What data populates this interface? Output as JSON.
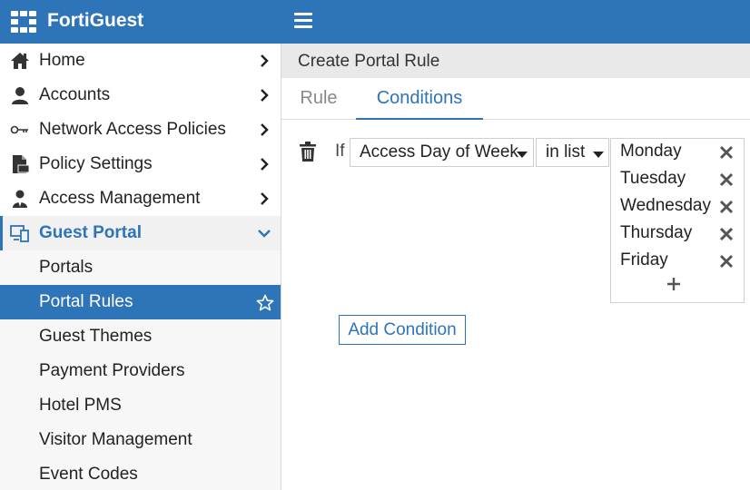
{
  "app": {
    "brand": "FortiGuest",
    "logo_icon": "fortinet-logo-icon",
    "menu_icon": "hamburger-icon",
    "accent_color": "#2d74b8"
  },
  "sidebar": {
    "items": [
      {
        "label": "Home",
        "icon": "home-icon"
      },
      {
        "label": "Accounts",
        "icon": "user-icon"
      },
      {
        "label": "Network Access Policies",
        "icon": "key-icon"
      },
      {
        "label": "Policy Settings",
        "icon": "document-icon"
      },
      {
        "label": "Access Management",
        "icon": "admin-user-icon"
      },
      {
        "label": "Guest Portal",
        "icon": "monitor-icon",
        "expanded": true
      }
    ],
    "sub_items": [
      {
        "label": "Portals"
      },
      {
        "label": "Portal Rules",
        "selected": true,
        "icon": "star-icon"
      },
      {
        "label": "Guest Themes"
      },
      {
        "label": "Payment Providers"
      },
      {
        "label": "Hotel PMS"
      },
      {
        "label": "Visitor Management"
      },
      {
        "label": "Event Codes"
      }
    ]
  },
  "main": {
    "title": "Create Portal Rule",
    "tabs": [
      {
        "label": "Rule",
        "active": false
      },
      {
        "label": "Conditions",
        "active": true
      }
    ],
    "condition": {
      "if_label": "If",
      "field": "Access Day of Week",
      "operator": "in list",
      "values": [
        "Monday",
        "Tuesday",
        "Wednesday",
        "Thursday",
        "Friday"
      ]
    },
    "add_condition_label": "Add Condition"
  }
}
